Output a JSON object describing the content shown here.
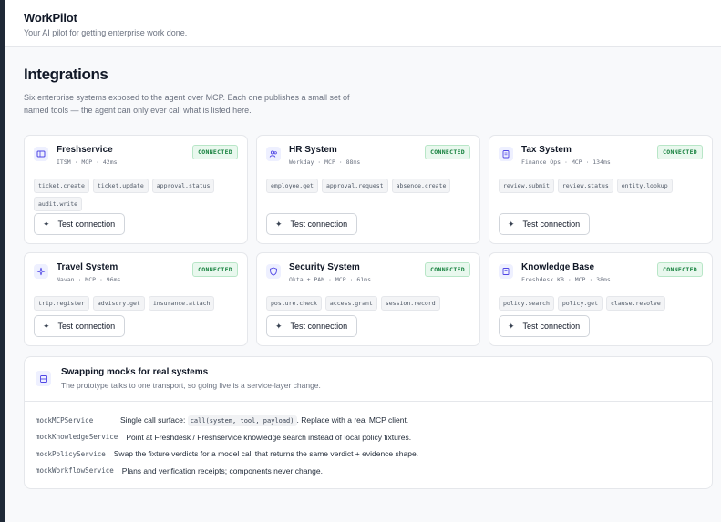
{
  "app": {
    "brand": "WorkPilot",
    "tagline": "Your AI pilot for getting enterprise work done."
  },
  "page": {
    "title": "Integrations",
    "description": "Six enterprise systems exposed to the agent over MCP. Each one publishes a small set of named tools — the agent can only ever call what is listed here."
  },
  "integrations": [
    {
      "name": "Freshservice",
      "meta": "ITSM · MCP · 42ms",
      "status": "CONNECTED",
      "icon": "ticket-icon",
      "tools": [
        "ticket.create",
        "ticket.update",
        "approval.status",
        "audit.write"
      ],
      "button": "Test connection"
    },
    {
      "name": "HR System",
      "meta": "Workday · MCP · 88ms",
      "status": "CONNECTED",
      "icon": "users-icon",
      "tools": [
        "employee.get",
        "approval.request",
        "absence.create"
      ],
      "button": "Test connection"
    },
    {
      "name": "Tax System",
      "meta": "Finance Ops · MCP · 134ms",
      "status": "CONNECTED",
      "icon": "clipboard-icon",
      "tools": [
        "review.submit",
        "review.status",
        "entity.lookup"
      ],
      "button": "Test connection"
    },
    {
      "name": "Travel System",
      "meta": "Navan · MCP · 96ms",
      "status": "CONNECTED",
      "icon": "plane-icon",
      "tools": [
        "trip.register",
        "advisory.get",
        "insurance.attach"
      ],
      "button": "Test connection"
    },
    {
      "name": "Security System",
      "meta": "Okta + PAM · MCP · 61ms",
      "status": "CONNECTED",
      "icon": "shield-icon",
      "tools": [
        "posture.check",
        "access.grant",
        "session.record"
      ],
      "button": "Test connection"
    },
    {
      "name": "Knowledge Base",
      "meta": "Freshdesk KB · MCP · 38ms",
      "status": "CONNECTED",
      "icon": "book-icon",
      "tools": [
        "policy.search",
        "policy.get",
        "clause.resolve"
      ],
      "button": "Test connection"
    }
  ],
  "notes": {
    "title": "Swapping mocks for real systems",
    "subtitle": "The prototype talks to one transport, so going live is a service-layer change.",
    "rows": [
      {
        "key": "mockMCPService",
        "before": "Single call surface: ",
        "code": "call(system, tool, payload)",
        "after": ". Replace with a real MCP client."
      },
      {
        "key": "mockKnowledgeService",
        "before": "Point at Freshdesk / Freshservice knowledge search instead of local policy fixtures.",
        "code": "",
        "after": ""
      },
      {
        "key": "mockPolicyService",
        "before": "Swap the fixture verdicts for a model call that returns the same verdict + evidence shape.",
        "code": "",
        "after": ""
      },
      {
        "key": "mockWorkflowService",
        "before": "Plans and verification receipts; components never change.",
        "code": "",
        "after": ""
      }
    ]
  },
  "colors": {
    "accent": "#4f46e5",
    "connected": "#15803d",
    "connected_bg": "#e9f8ee"
  }
}
